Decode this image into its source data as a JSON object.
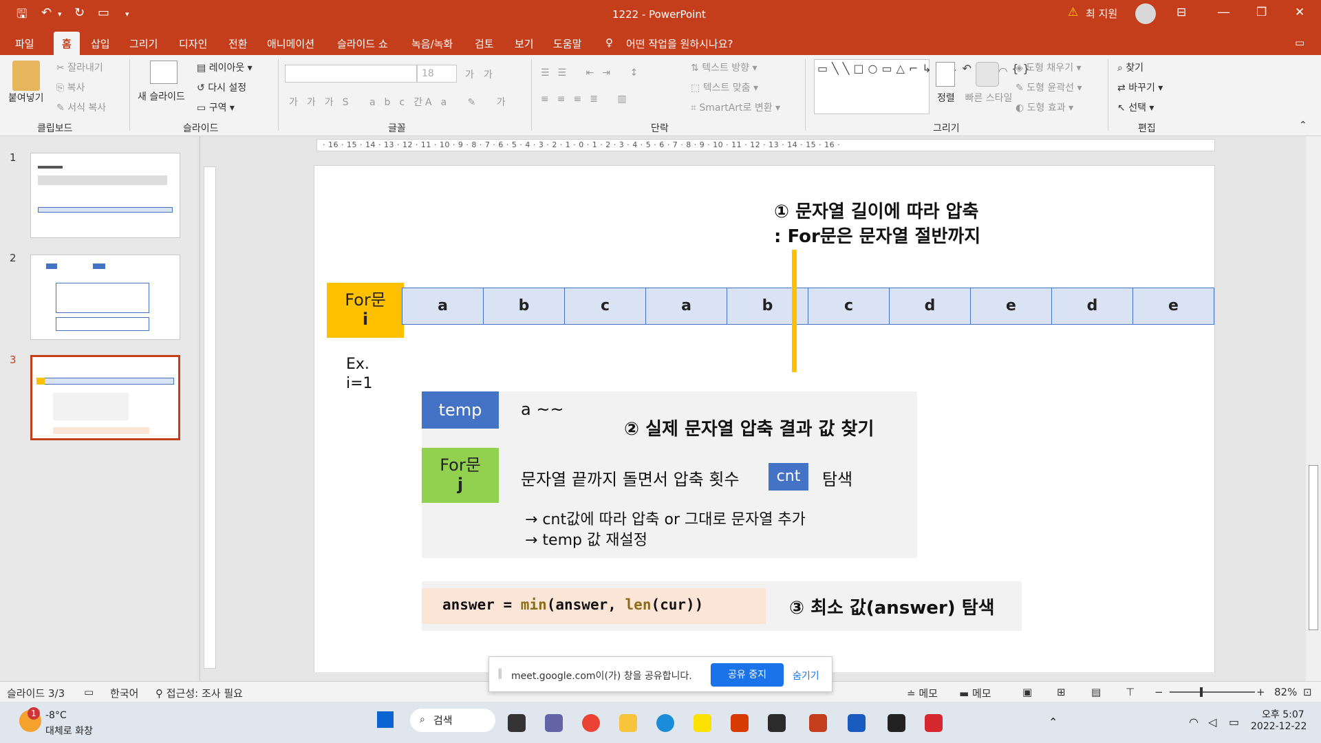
{
  "window": {
    "title": "1222 - PowerPoint",
    "user_name": "최 지원",
    "controls": [
      "―",
      "❐",
      "✕"
    ]
  },
  "quick_access": [
    "save-icon",
    "undo-icon",
    "redo-icon",
    "present-icon"
  ],
  "tabs": [
    "파일",
    "홈",
    "삽입",
    "그리기",
    "디자인",
    "전환",
    "애니메이션",
    "슬라이드 쇼",
    "녹음/녹화",
    "검토",
    "보기",
    "도움말"
  ],
  "active_tab": "홈",
  "tell_me": "어떤 작업을 원하시나요?",
  "ribbon": {
    "clipboard": {
      "paste": "붙여넣기",
      "cut": "잘라내기",
      "copy": "복사",
      "format_painter": "서식 복사",
      "label": "클립보드"
    },
    "slides": {
      "new_slide": "새 슬라이드",
      "layout": "레이아웃",
      "reset": "다시 설정",
      "section": "구역",
      "label": "슬라이드"
    },
    "font": {
      "size": "18",
      "label": "글꼴"
    },
    "paragraph": {
      "text_direction": "텍스트 방향",
      "align_text": "텍스트 맞춤",
      "smartart": "SmartArt로 변환",
      "label": "단락"
    },
    "drawing": {
      "arrange": "정렬",
      "quick_styles": "빠른 스타일",
      "fill": "도형 채우기",
      "outline": "도형 윤곽선",
      "effects": "도형 효과",
      "label": "그리기"
    },
    "editing": {
      "find": "찾기",
      "replace": "바꾸기",
      "select": "선택",
      "label": "편집"
    }
  },
  "thumbnails": [
    {
      "num": "1",
      "selected": false
    },
    {
      "num": "2",
      "selected": false
    },
    {
      "num": "3",
      "selected": true
    }
  ],
  "ruler": {
    "horizontal": "· 16 · 15 · 14 · 13 · 12 · 11 · 10 · 9 · 8 · 7 · 6 · 5 · 4 · 3 · 2 · 1 · 0 · 1 · 2 · 3 · 4 · 5 · 6 · 7 · 8 · 9 · 10 · 11 · 12 · 13 · 14 · 15 · 16 ·"
  },
  "slide": {
    "heading1_line1": "① 문자열 길이에 따라 압축",
    "heading1_line2": ": For문은 문자열 절반까지",
    "for_i_line1": "For문",
    "for_i_line2": "i",
    "cells": [
      "a",
      "b",
      "c",
      "a",
      "b",
      "c",
      "d",
      "e",
      "d",
      "e"
    ],
    "ex_line1": "Ex.",
    "ex_line2": "i=1",
    "temp_label": "temp",
    "temp_value": "a ~~",
    "heading2": "② 실제 문자열 압축 결과 값 찾기",
    "for_j_line1": "For문",
    "for_j_line2": "j",
    "loop_desc": "문자열 끝까지 돌면서 압축 횟수",
    "cnt_label": "cnt",
    "loop_action": "탐색",
    "arrow1": "→ cnt값에 따라 압축 or 그대로 문자열 추가",
    "arrow2": "→ temp 값 재설정",
    "code": {
      "p1": "answer = ",
      "fn1": "min",
      "p2": "(answer, ",
      "fn2": "len",
      "p3": "(cur))"
    },
    "heading3": "③ 최소 값(answer) 탐색"
  },
  "share_banner": {
    "message": "meet.google.com이(가) 창을 공유합니다.",
    "stop": "공유 중지",
    "hide": "숨기기"
  },
  "status": {
    "slide_count": "슬라이드 3/3",
    "language": "한국어",
    "accessibility": "접근성: 조사 필요",
    "notes": "메모",
    "comments": "메모",
    "zoom": "82%"
  },
  "taskbar": {
    "weather_temp": "-8°C",
    "weather_desc": "대체로 화창",
    "weather_badge": "1",
    "search": "검색",
    "time": "오후 5:07",
    "date": "2022-12-22"
  },
  "colors": {
    "accent": "#c43e1c",
    "cell_fill": "#dae3f3",
    "cell_border": "#4472c4",
    "for_i_box": "#ffc000",
    "for_j_box": "#92d050",
    "temp_box": "#4472c4",
    "code_bg": "#fbe5d6"
  }
}
